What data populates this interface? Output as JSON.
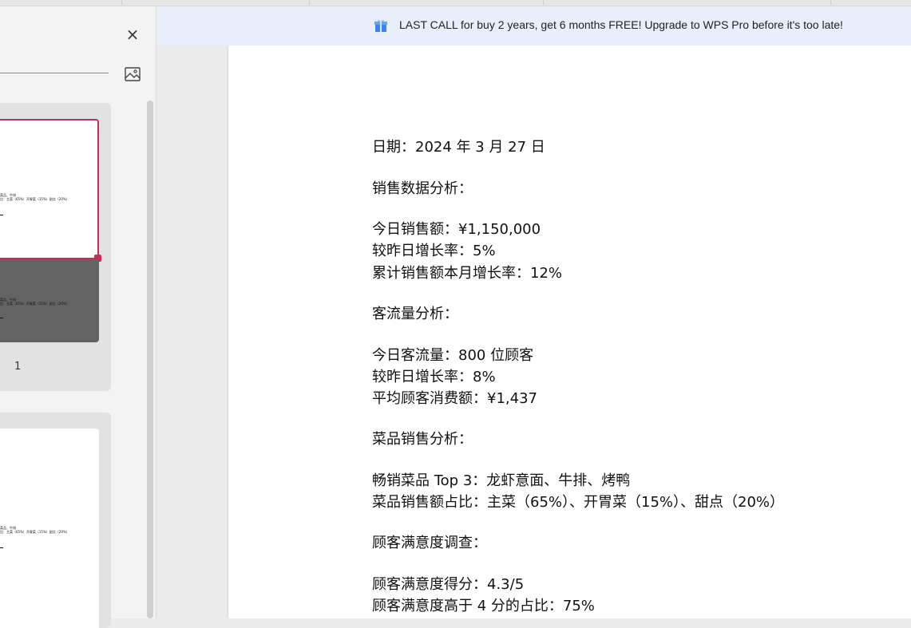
{
  "banner": {
    "text": "LAST CALL for buy 2 years, get 6 months FREE! Upgrade to WPS Pro before it's too late!",
    "icon": "gift-icon"
  },
  "panel": {
    "close_icon": "×",
    "thumbnails": [
      {
        "page_number": "1",
        "selected": true
      },
      {
        "page_number": "",
        "selected": false
      }
    ],
    "accent_color": "#c0305a"
  },
  "document": {
    "lines": [
      "日期：2024 年 3 月 27 日",
      "销售数据分析：",
      "今日销售额：¥1,150,000",
      "较昨日增长率：5%",
      "累计销售额本月增长率：12%",
      "客流量分析：",
      "今日客流量：800 位顾客",
      "较昨日增长率：8%",
      "平均顾客消费额：¥1,437",
      "菜品销售分析：",
      "畅销菜品 Top 3：龙虾意面、牛排、烤鸭",
      "菜品销售额占比：主菜（65%）、开胃菜（15%）、甜点（20%）",
      "顾客满意度调查：",
      "顾客满意度得分：4.3/5",
      "顾客满意度高于 4 分的占比：75%"
    ]
  }
}
